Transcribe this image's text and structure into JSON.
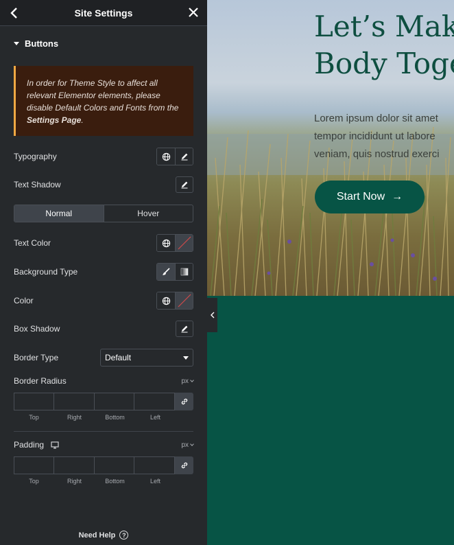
{
  "header": {
    "title": "Site Settings"
  },
  "section": {
    "title": "Buttons"
  },
  "notice": {
    "text": "In order for Theme Style to affect all relevant Elementor elements, please disable Default Colors and Fonts from the ",
    "link": "Settings Page",
    "end": "."
  },
  "controls": {
    "typography": "Typography",
    "text_shadow": "Text Shadow",
    "tabs": [
      "Normal",
      "Hover"
    ],
    "text_color": "Text Color",
    "background_type": "Background Type",
    "color": "Color",
    "box_shadow": "Box Shadow",
    "border_type": {
      "label": "Border Type",
      "value": "Default"
    },
    "border_radius": {
      "label": "Border Radius",
      "unit": "px"
    },
    "padding": {
      "label": "Padding",
      "unit": "px"
    },
    "dim_labels": [
      "Top",
      "Right",
      "Bottom",
      "Left"
    ]
  },
  "footer": {
    "help": "Need Help",
    "help_icon": "?"
  },
  "preview": {
    "title_line1": "Let’s Make",
    "title_line2": "Body Toge",
    "text_line1": "Lorem ipsum dolor sit amet",
    "text_line2": "tempor incididunt ut labore",
    "text_line3": "veniam, quis nostrud exerci",
    "button": "Start Now",
    "button_arrow": "→"
  },
  "colors": {
    "panel": "#26292c",
    "accent_green": "#075445",
    "notice_bg": "#3a1d0e",
    "notice_border": "#f0a843"
  }
}
